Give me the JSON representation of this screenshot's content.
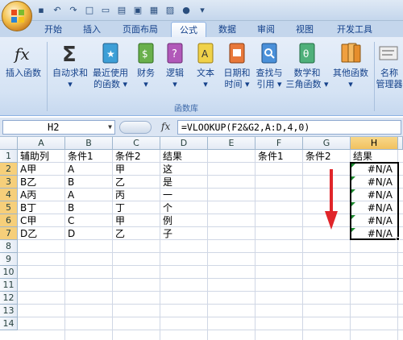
{
  "quick_access": [
    "save",
    "undo",
    "redo"
  ],
  "tabs": [
    "开始",
    "插入",
    "页面布局",
    "公式",
    "数据",
    "审阅",
    "视图",
    "开发工具"
  ],
  "active_tab": "公式",
  "ribbon": {
    "buttons": [
      {
        "label1": "插入函数",
        "label2": "",
        "icon": "fx-icon"
      },
      {
        "label1": "自动求和",
        "label2": "▾",
        "icon": "sigma-icon"
      },
      {
        "label1": "最近使用",
        "label2": "的函数 ▾",
        "icon": "recent-functions-book-icon"
      },
      {
        "label1": "财务",
        "label2": "▾",
        "icon": "financial-book-icon"
      },
      {
        "label1": "逻辑",
        "label2": "▾",
        "icon": "logical-book-icon"
      },
      {
        "label1": "文本",
        "label2": "▾",
        "icon": "text-book-icon"
      },
      {
        "label1": "日期和",
        "label2": "时间 ▾",
        "icon": "datetime-book-icon"
      },
      {
        "label1": "查找与",
        "label2": "引用 ▾",
        "icon": "lookup-book-icon"
      },
      {
        "label1": "数学和",
        "label2": "三角函数 ▾",
        "icon": "math-book-icon"
      },
      {
        "label1": "其他函数",
        "label2": "▾",
        "icon": "more-functions-book-icon"
      },
      {
        "label1": "名称",
        "label2": "管理器",
        "icon": "name-manager-icon"
      }
    ],
    "group_label": "函数库"
  },
  "formula_bar": {
    "name_box": "H2",
    "fx_label": "fx",
    "formula": "=VLOOKUP(F2&G2,A:D,4,0)"
  },
  "sheet": {
    "columns": [
      "A",
      "B",
      "C",
      "D",
      "E",
      "F",
      "G",
      "H"
    ],
    "rows": [
      "1",
      "2",
      "3",
      "4",
      "5",
      "6",
      "7",
      "8",
      "9",
      "10",
      "11",
      "12",
      "13",
      "14"
    ],
    "cells": {
      "A1": "辅助列",
      "B1": "条件1",
      "C1": "条件2",
      "D1": "结果",
      "F1": "条件1",
      "G1": "条件2",
      "H1": "结果",
      "A2": "A甲",
      "B2": "A",
      "C2": "甲",
      "D2": "这",
      "H2": "#N/A",
      "A3": "B乙",
      "B3": "B",
      "C3": "乙",
      "D3": "是",
      "H3": "#N/A",
      "A4": "A丙",
      "B4": "A",
      "C4": "丙",
      "D4": "一",
      "H4": "#N/A",
      "A5": "B丁",
      "B5": "B",
      "C5": "丁",
      "D5": "个",
      "H5": "#N/A",
      "A6": "C甲",
      "B6": "C",
      "C6": "甲",
      "D6": "例",
      "H6": "#N/A",
      "A7": "D乙",
      "B7": "D",
      "C7": "乙",
      "D7": "子",
      "H7": "#N/A"
    }
  },
  "colors": {
    "selection_header": "#f6cf7a",
    "error_triangle": "#1c8a2f",
    "annotation_arrow": "#e0252a"
  }
}
